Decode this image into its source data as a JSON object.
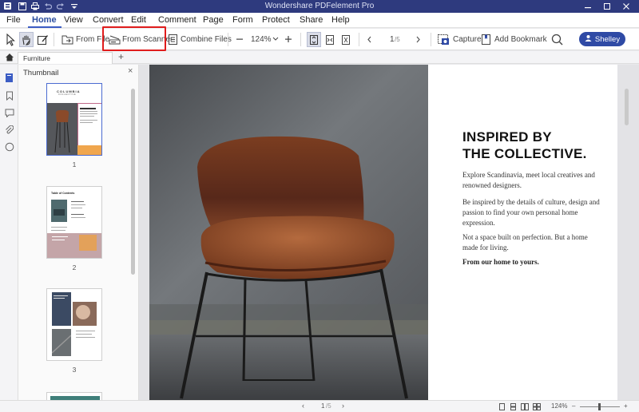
{
  "window": {
    "title": "Wondershare PDFelement Pro"
  },
  "menu": [
    "File",
    "Home",
    "View",
    "Convert",
    "Edit",
    "Comment",
    "Page",
    "Form",
    "Protect",
    "Share",
    "Help"
  ],
  "toolbar": {
    "from_file": "From File",
    "from_scanner": "From Scanner",
    "combine_files": "Combine Files",
    "zoom": "124%",
    "page_current": "1",
    "page_total": "/5",
    "capture": "Capture",
    "add_bookmark": "Add Bookmark",
    "user": "Shelley"
  },
  "tab": {
    "name": "Furniture",
    "add": "+"
  },
  "sidebar": {
    "title": "Thumbnail",
    "close": "×",
    "pages": [
      "1",
      "2",
      "3"
    ]
  },
  "thumb1": {
    "brand": "COLUMBIA",
    "brand_sub": "C O L L E C T I V E"
  },
  "thumb2": {
    "title": "Table of Contents"
  },
  "document": {
    "heading_line1": "INSPIRED BY",
    "heading_line2": "THE COLLECTIVE.",
    "para1": "Explore Scandinavia, meet local creatives and renowned designers.",
    "para2": "Be inspired by the details of culture, design and passion to find your own personal home expression.",
    "para3": "Not a space built on perfection. But a home made for living.",
    "para4": "From our home to yours."
  },
  "status": {
    "page_current": "1",
    "page_total": "/5",
    "zoom": "124%"
  },
  "colors": {
    "titlebar": "#2e3a7e",
    "accent": "#2f4aa5",
    "highlight": "#e01d1d",
    "chair_leather": "#8a4a2a"
  }
}
